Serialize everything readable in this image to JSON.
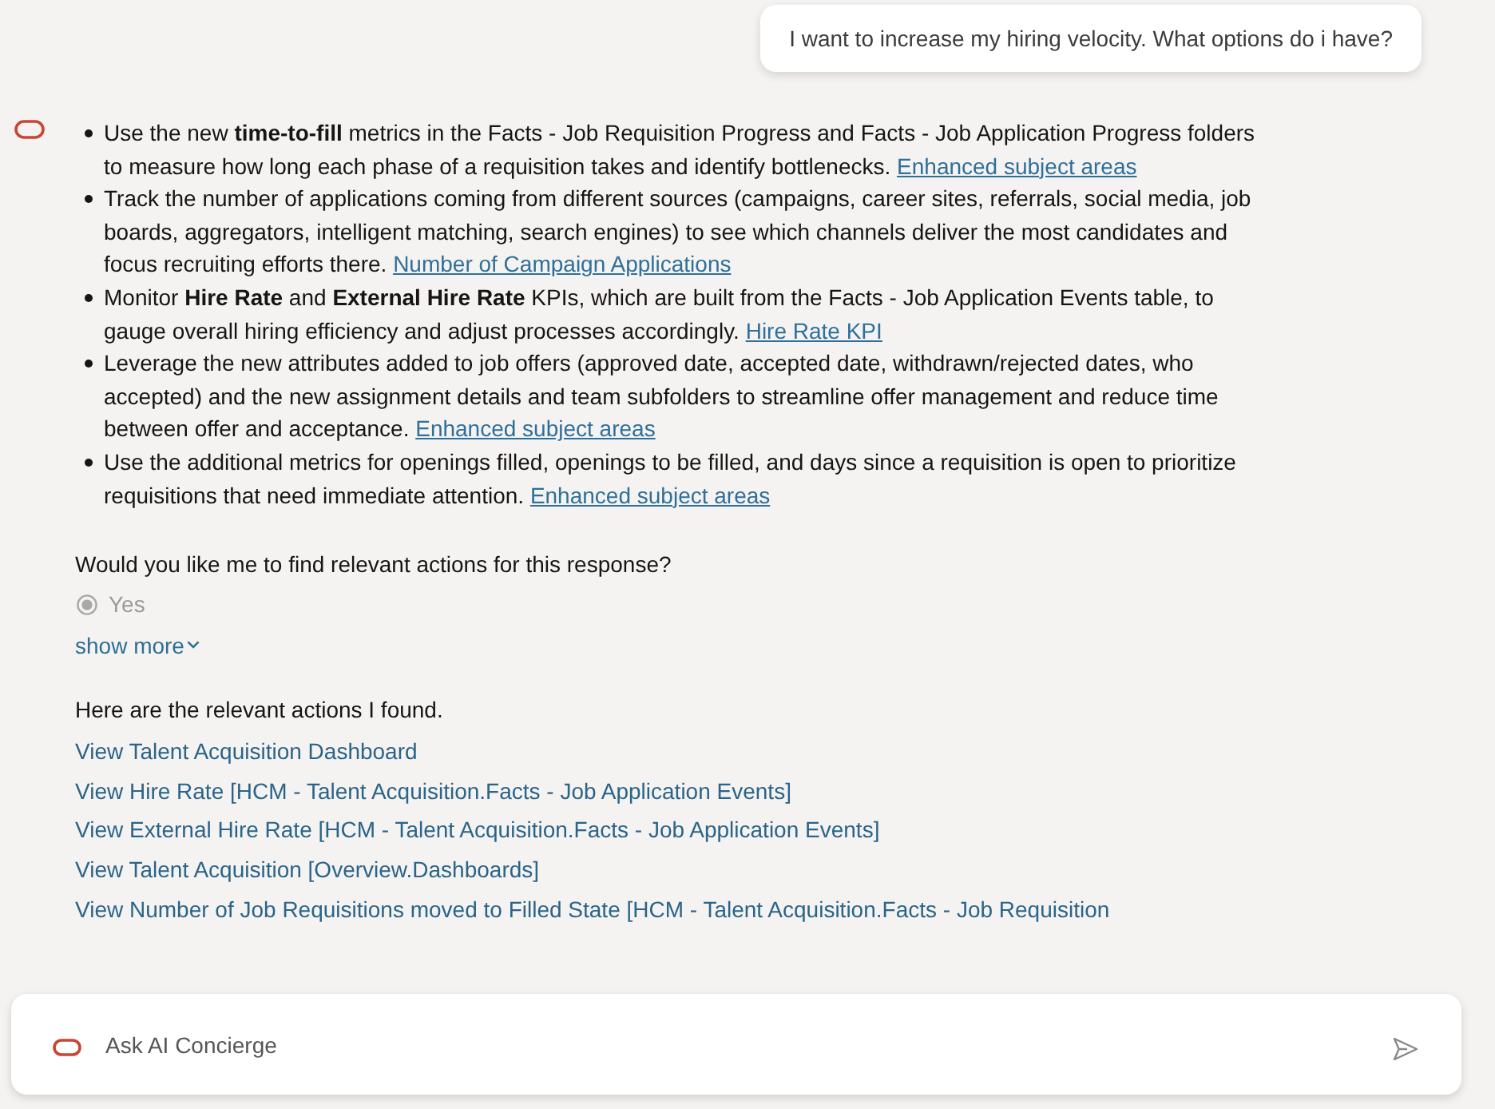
{
  "user_message": {
    "text": "I want to increase my hiring velocity. What options do i have?"
  },
  "response": {
    "bullets": [
      {
        "text": "Use the new **time-to-fill** metrics in the Facts - Job Requisition Progress and Facts - Job Application Progress folders to measure how long each phase of a requisition takes and identify bottlenecks.",
        "link": "Enhanced subject areas"
      },
      {
        "text": "Track the number of applications coming from different sources (campaigns, career sites, referrals, social media, job boards, aggregators, intelligent matching, search engines) to see which channels deliver the most candidates and focus recruiting efforts there.",
        "link": "Number of Campaign Applications"
      },
      {
        "text": "Monitor **Hire Rate** and **External Hire Rate** KPIs, which are built from the Facts - Job Application Events table, to gauge overall hiring efficiency and adjust processes accordingly.",
        "link": "Hire Rate KPI"
      },
      {
        "text": "Leverage the new attributes added to job offers (approved date, accepted date, withdrawn/rejected dates, who accepted) and the new assignment details and team subfolders to streamline offer management and reduce time between offer and acceptance.",
        "link": "Enhanced subject areas"
      },
      {
        "text": "Use the additional metrics for openings filled, openings to be filled, and days since a requisition is open to prioritize requisitions that need immediate attention.",
        "link": "Enhanced subject areas"
      }
    ],
    "question": {
      "text": "Would you like me to find relevant actions for this response?",
      "disabled": true,
      "options": [
        {
          "label": "Yes",
          "selected": true
        }
      ]
    },
    "show_more": {
      "label": "show more",
      "expanded": false
    },
    "actions_intro": "Here are the relevant actions I found.",
    "actions": [
      "View Talent Acquisition Dashboard",
      "View Hire Rate [HCM - Talent Acquisition.Facts - Job Application Events]",
      "View External Hire Rate [HCM - Talent Acquisition.Facts - Job Application Events]",
      "View Talent Acquisition [Overview.Dashboards]",
      "View Number of Job Requisitions moved to Filled State [HCM - Talent Acquisition.Facts - Job Requisition"
    ]
  },
  "composer": {
    "placeholder": "Ask AI Concierge"
  }
}
